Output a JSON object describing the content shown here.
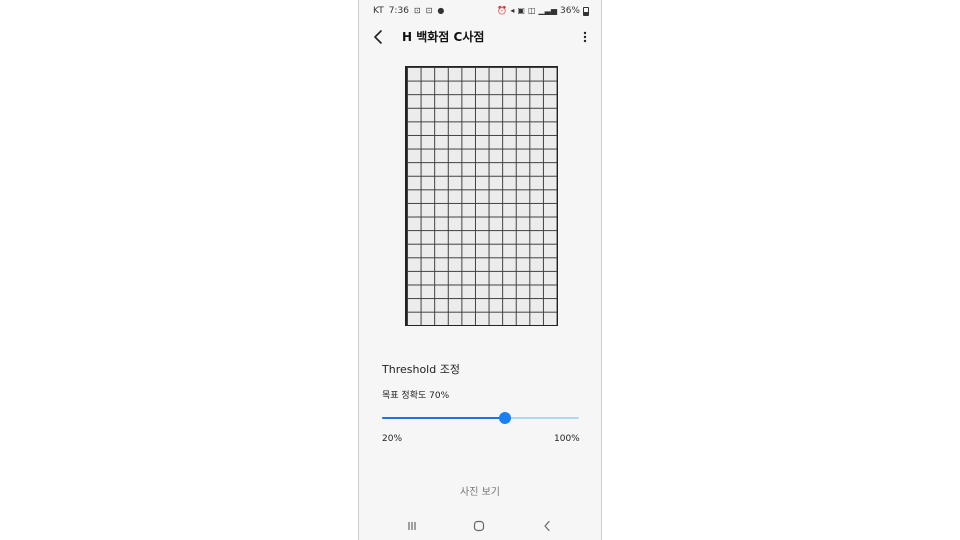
{
  "status_bar": {
    "carrier": "KT",
    "time": "7:36",
    "battery": "36%",
    "left_icons": [
      "face-detect-icon",
      "face-detect-icon",
      "chat-icon"
    ],
    "right_icons": [
      "alarm-icon",
      "mute-icon",
      "lte-icon",
      "wifi-icon",
      "signal-icon"
    ]
  },
  "app_bar": {
    "title": "H 백화점 C사점"
  },
  "image": {
    "description_icon": "grid-photo"
  },
  "threshold": {
    "title": "Threshold 조정",
    "target_accuracy_label": "목표 정확도 70%",
    "value": 70,
    "min": 20,
    "max": 100,
    "min_label": "20%",
    "max_label": "100%"
  },
  "actions": {
    "view_photo": "사진 보기"
  },
  "colors": {
    "accent": "#1a7ff0",
    "track_inactive": "#a8dcef",
    "background": "#f6f6f6"
  }
}
